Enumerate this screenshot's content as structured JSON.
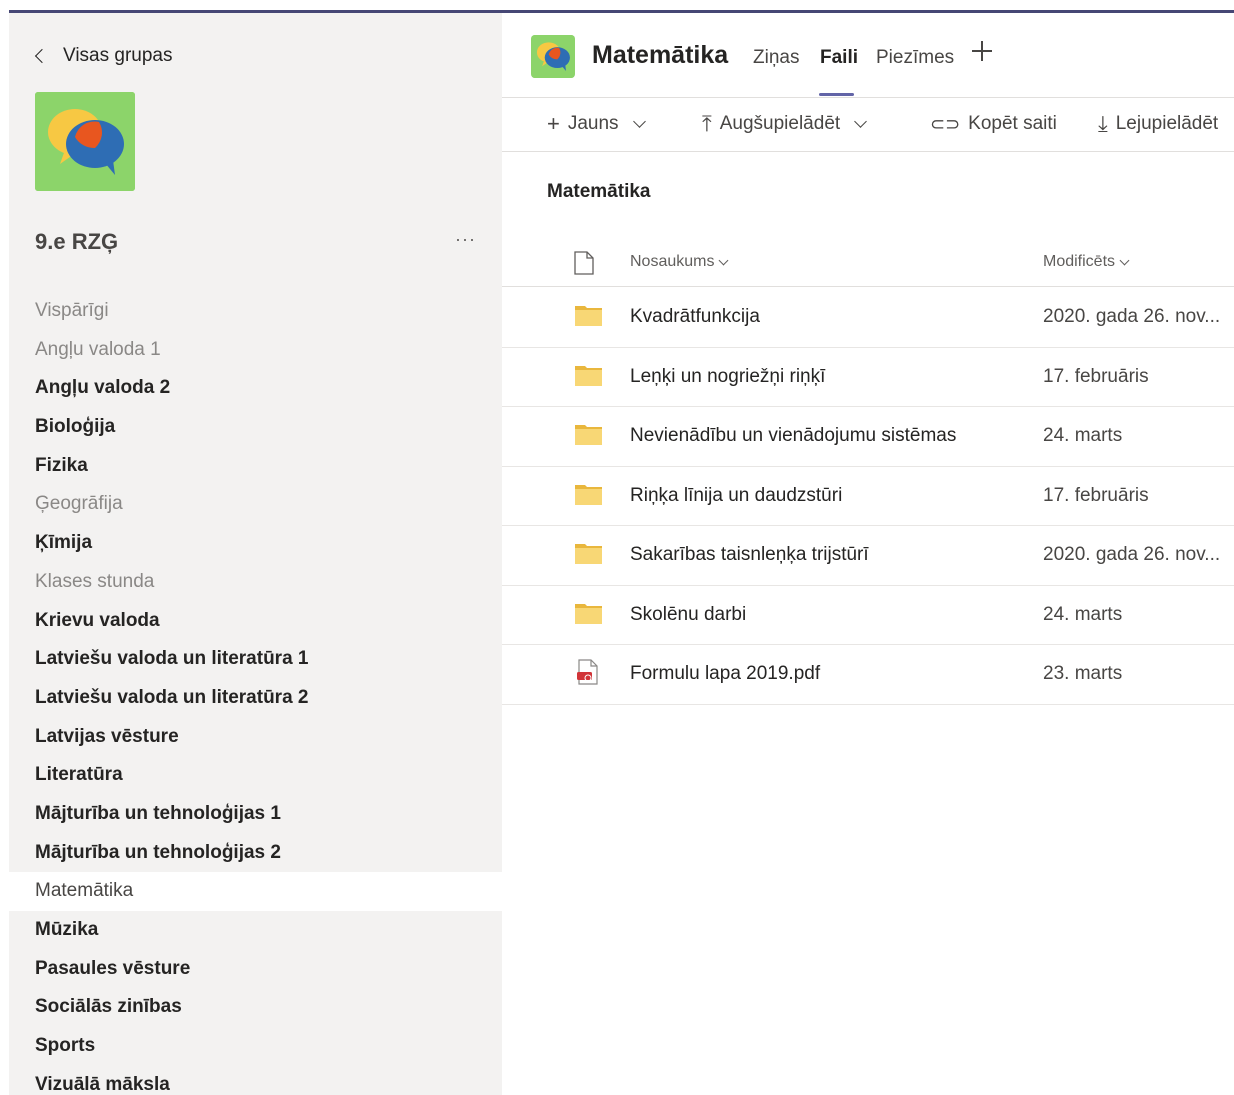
{
  "sidebar": {
    "back_label": "Visas grupas",
    "team_name": "9.e RZĢ",
    "more_label": "···",
    "channels": [
      {
        "label": "Vispārīgi",
        "style": "muted"
      },
      {
        "label": "Angļu valoda 1",
        "style": "muted"
      },
      {
        "label": "Angļu valoda 2",
        "style": "unread"
      },
      {
        "label": "Bioloģija",
        "style": "unread"
      },
      {
        "label": "Fizika",
        "style": "unread"
      },
      {
        "label": "Ģeogrāfija",
        "style": "muted"
      },
      {
        "label": "Ķīmija",
        "style": "unread"
      },
      {
        "label": "Klases stunda",
        "style": "muted"
      },
      {
        "label": "Krievu valoda",
        "style": "unread"
      },
      {
        "label": "Latviešu valoda un literatūra 1",
        "style": "unread"
      },
      {
        "label": "Latviešu valoda un literatūra 2",
        "style": "unread"
      },
      {
        "label": "Latvijas vēsture",
        "style": "unread"
      },
      {
        "label": "Literatūra",
        "style": "unread"
      },
      {
        "label": "Mājturība un tehnoloģijas 1",
        "style": "unread"
      },
      {
        "label": "Mājturība un tehnoloģijas 2",
        "style": "unread"
      },
      {
        "label": "Matemātika",
        "style": "active"
      },
      {
        "label": "Mūzika",
        "style": "unread"
      },
      {
        "label": "Pasaules vēsture",
        "style": "unread"
      },
      {
        "label": "Sociālās zinības",
        "style": "unread"
      },
      {
        "label": "Sports",
        "style": "unread"
      },
      {
        "label": "Vizuālā māksla",
        "style": "unread"
      }
    ]
  },
  "header": {
    "channel_title": "Matemātika",
    "tabs": [
      {
        "label": "Ziņas"
      },
      {
        "label": "Faili",
        "active": true
      },
      {
        "label": "Piezīmes"
      }
    ],
    "add_tab_icon": "plus-icon"
  },
  "toolbar": {
    "new_label": "Jauns",
    "upload_label": "Augšupielādēt",
    "copy_link_label": "Kopēt saiti",
    "download_label": "Lejupielādēt"
  },
  "breadcrumb": "Matemātika",
  "table": {
    "columns": {
      "name": "Nosaukums",
      "modified": "Modificēts"
    },
    "rows": [
      {
        "type": "folder",
        "name": "Kvadrātfunkcija",
        "modified": "2020. gada 26. nov..."
      },
      {
        "type": "folder",
        "name": "Leņķi un nogriežņi riņķī",
        "modified": "17. februāris"
      },
      {
        "type": "folder",
        "name": "Nevienādību un vienādojumu sistēmas",
        "modified": "24. marts"
      },
      {
        "type": "folder",
        "name": "Riņķa līnija un daudzstūri",
        "modified": "17. februāris"
      },
      {
        "type": "folder",
        "name": "Sakarības taisnleņķa trijstūrī",
        "modified": "2020. gada 26. nov..."
      },
      {
        "type": "folder",
        "name": "Skolēnu darbi",
        "modified": "24. marts"
      },
      {
        "type": "pdf",
        "name": "Formulu lapa 2019.pdf",
        "modified": "23. marts"
      }
    ]
  },
  "colors": {
    "accent": "#6264a7",
    "topline": "#464775",
    "sidebar_bg": "#f3f2f1",
    "avatar_bg": "#8cd46a",
    "folder": "#f8d775",
    "pdf": "#d13438"
  }
}
